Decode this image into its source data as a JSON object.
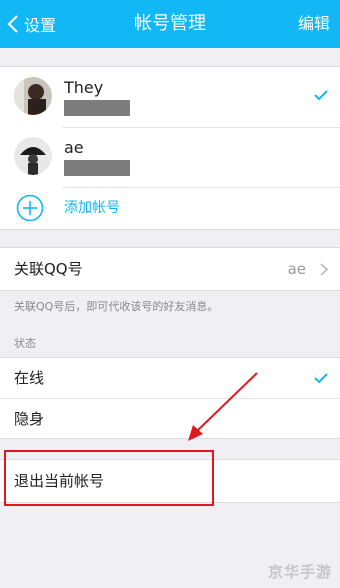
{
  "navbar": {
    "back_label": "设置",
    "title": "帐号管理",
    "edit_label": "编辑"
  },
  "accounts": [
    {
      "name": "They",
      "active": true
    },
    {
      "name": "ae",
      "active": false
    }
  ],
  "add_account_label": "添加帐号",
  "linked_qq": {
    "label": "关联QQ号",
    "value": "ae",
    "hint": "关联QQ号后，即可代收该号的好友消息。"
  },
  "status": {
    "section_label": "状态",
    "options": [
      {
        "label": "在线",
        "selected": true
      },
      {
        "label": "隐身",
        "selected": false
      }
    ]
  },
  "logout_label": "退出当前帐号",
  "watermark": "京华手游",
  "colors": {
    "accent": "#12b7f5",
    "annotation": "#e0191f"
  }
}
